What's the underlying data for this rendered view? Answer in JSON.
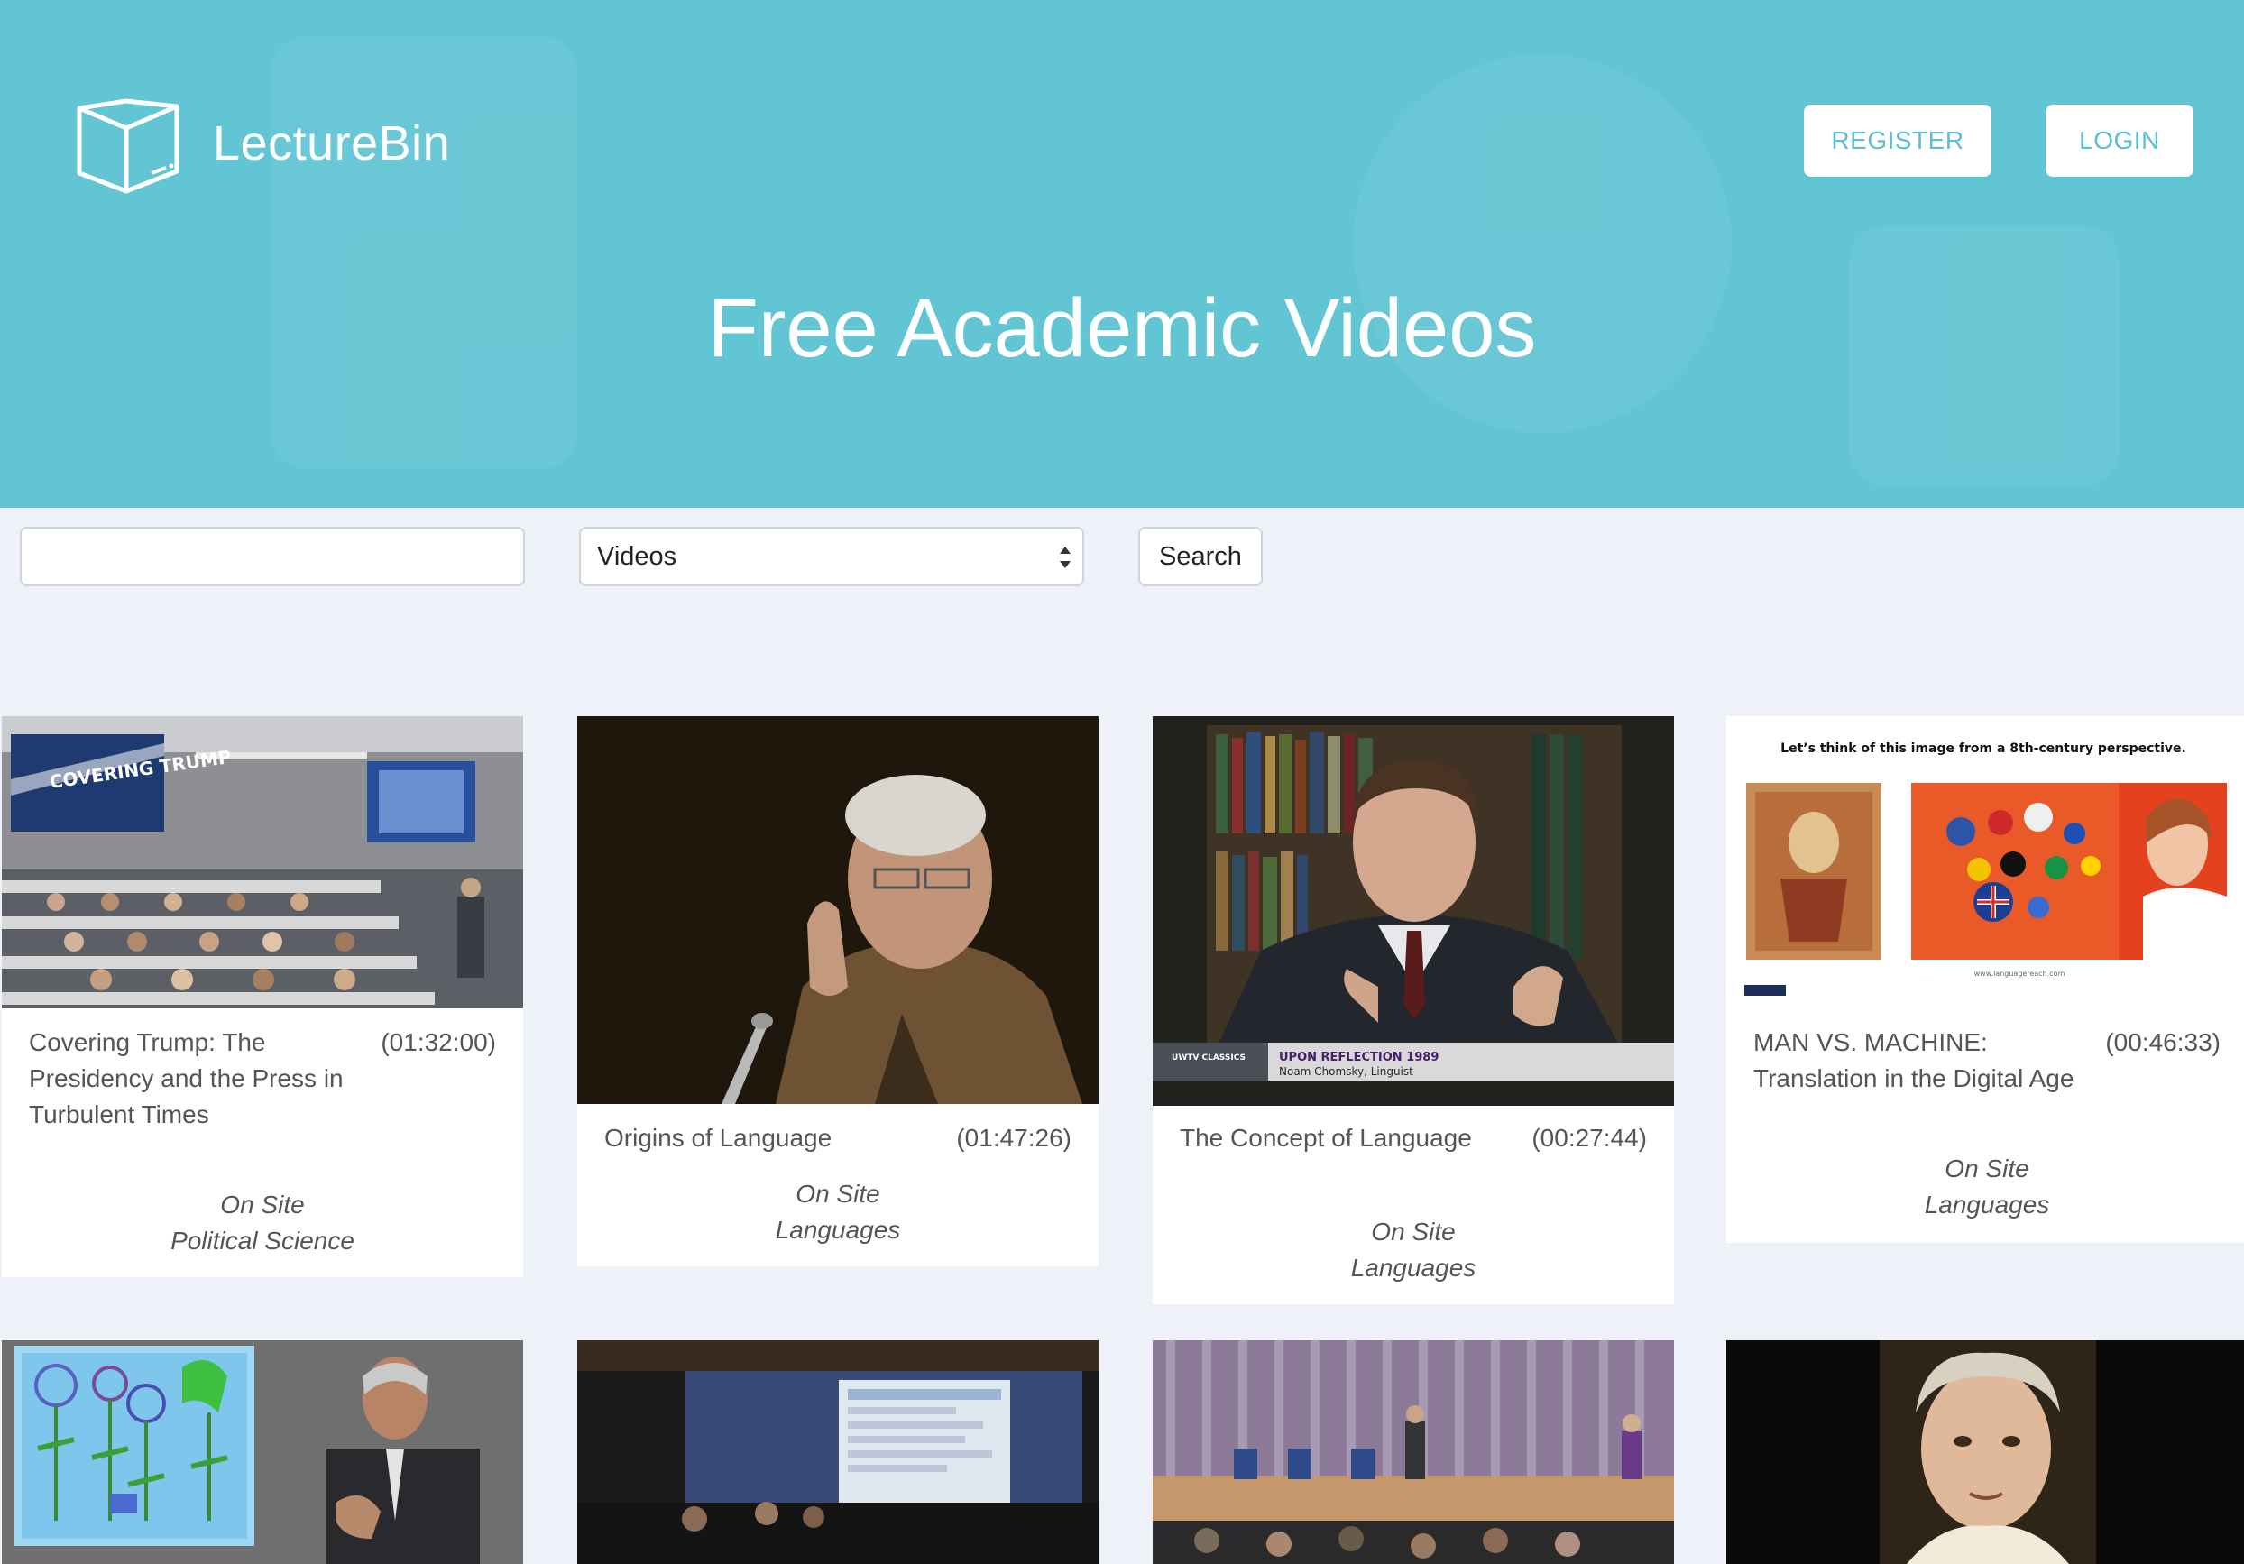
{
  "header": {
    "brand": "LectureBin",
    "hero_title": "Free Academic Videos",
    "register_label": "REGISTER",
    "login_label": "LOGIN",
    "colors": {
      "hero": "#62c5d3",
      "button_text": "#5bbfcf"
    }
  },
  "search": {
    "input_value": "",
    "select_value": "Videos",
    "button_label": "Search"
  },
  "thumbs": {
    "covering_trump_screen": "COVERING TRUMP",
    "chomsky_caption_channel": "UWTV CLASSICS",
    "chomsky_caption_title": "UPON REFLECTION 1989",
    "chomsky_caption_sub": "Noam Chomsky, Linguist",
    "machine_slide_heading": "Let’s think of this image from a 8th-century perspective.",
    "machine_slide_url": "www.languagereach.com"
  },
  "videos": [
    {
      "title": "Covering Trump: The Presidency and the Press in Turbulent Times",
      "duration": "(01:32:00)",
      "location": "On Site",
      "category": "Political Science"
    },
    {
      "title": "Origins of Language",
      "duration": "(01:47:26)",
      "location": "On Site",
      "category": "Languages"
    },
    {
      "title": "The Concept of Language",
      "duration": "(00:27:44)",
      "location": "On Site",
      "category": "Languages"
    },
    {
      "title": "MAN VS. MACHINE: Translation in the Digital Age",
      "duration": "(00:46:33)",
      "location": "On Site",
      "category": "Languages"
    }
  ]
}
